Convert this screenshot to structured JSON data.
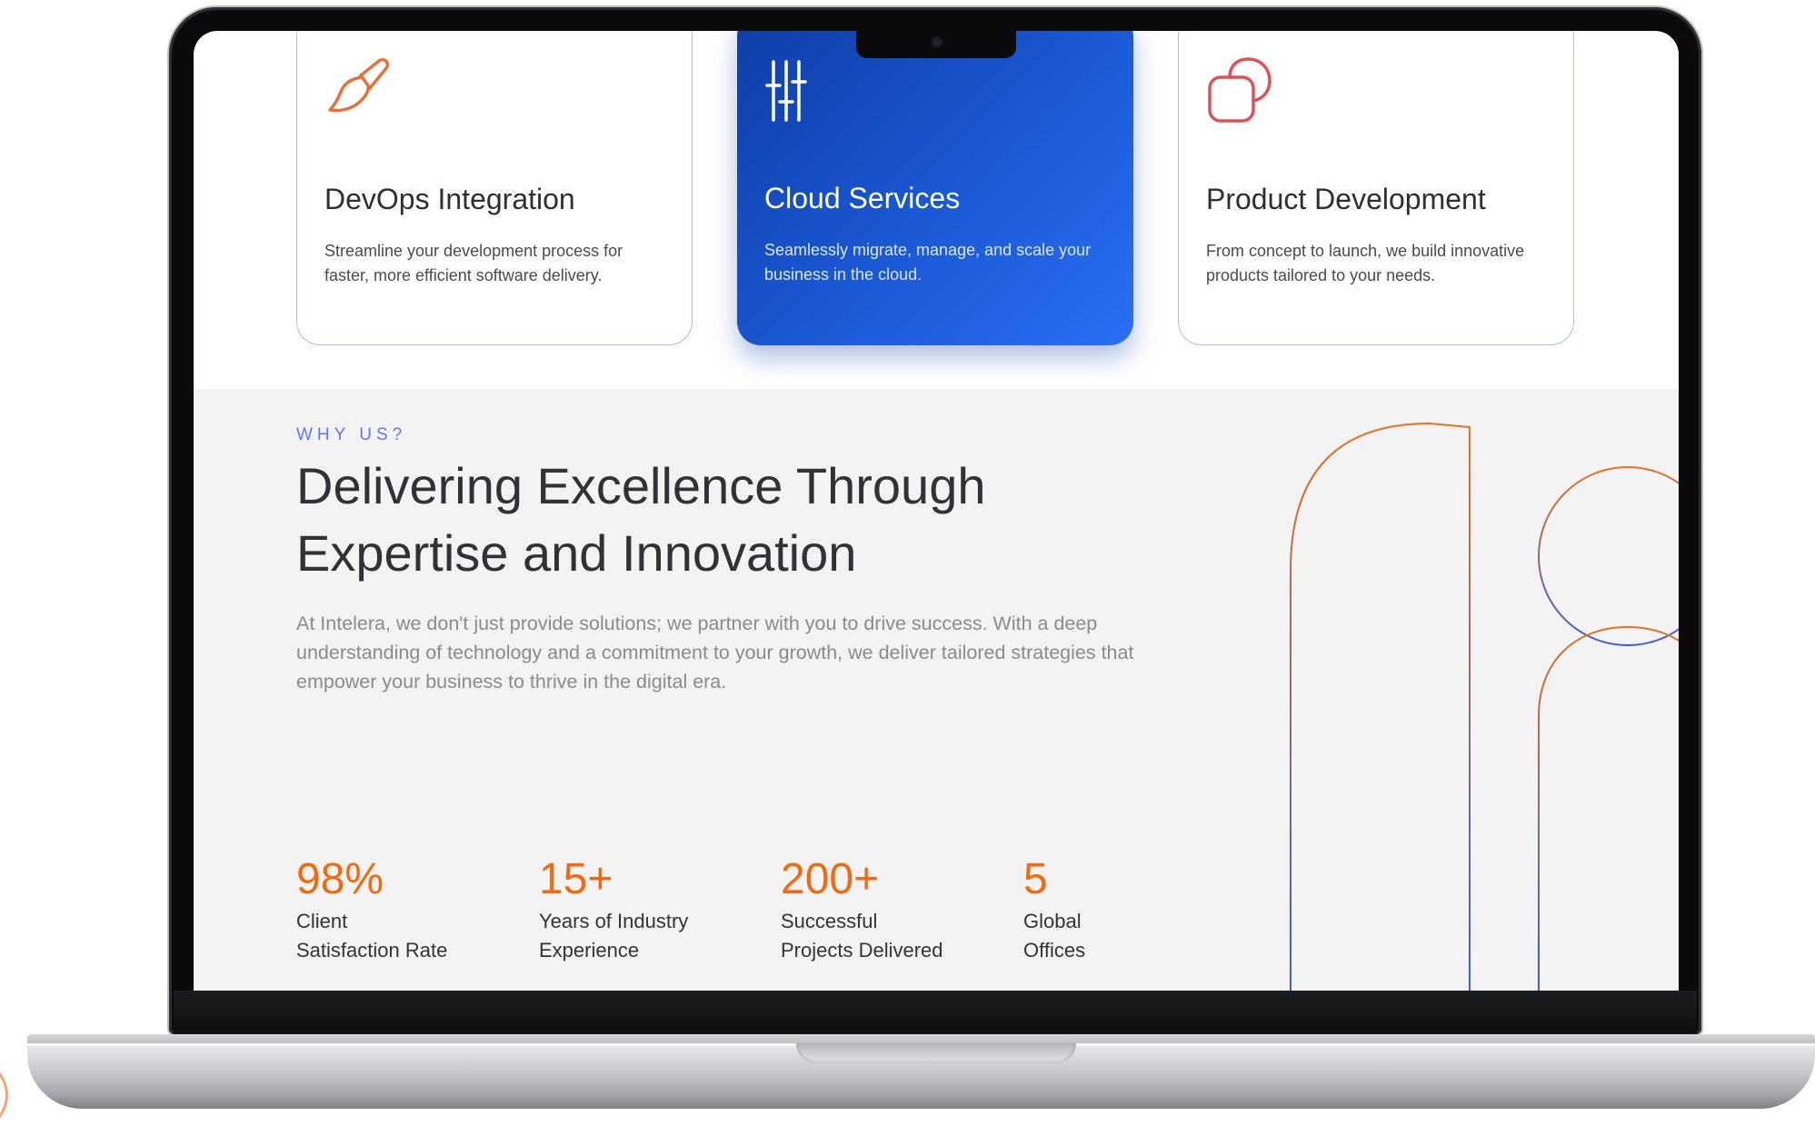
{
  "services": {
    "cards": [
      {
        "icon": "paintbrush-icon",
        "title": "DevOps Integration",
        "description": "Streamline your development process for faster, more efficient software delivery."
      },
      {
        "icon": "sliders-icon",
        "title": "Cloud Services",
        "description": "Seamlessly migrate, manage, and scale your business in the cloud."
      },
      {
        "icon": "overlapping-squares-icon",
        "title": "Product Development",
        "description": "From concept to launch, we build innovative products tailored to your needs."
      }
    ]
  },
  "why_us": {
    "eyebrow": "WHY US?",
    "headline_line1": "Delivering Excellence Through",
    "headline_line2": "Expertise and Innovation",
    "lead": "At Intelera, we don't just provide solutions; we partner with you to drive success. With a deep understanding of technology and a commitment to your growth, we deliver tailored strategies that empower your business to thrive in the digital era.",
    "stats": [
      {
        "value": "98%",
        "label_line1": "Client",
        "label_line2": "Satisfaction Rate"
      },
      {
        "value": "15+",
        "label_line1": "Years of Industry",
        "label_line2": "Experience"
      },
      {
        "value": "200+",
        "label_line1": "Successful",
        "label_line2": "Projects Delivered"
      },
      {
        "value": "5",
        "label_line1": "Global",
        "label_line2": "Offices"
      }
    ]
  },
  "colors": {
    "accent_orange": "#f26a10",
    "accent_blue": "#1b59d6",
    "eyebrow_blue": "#6277e8",
    "section_bg": "#f3f3f3"
  }
}
